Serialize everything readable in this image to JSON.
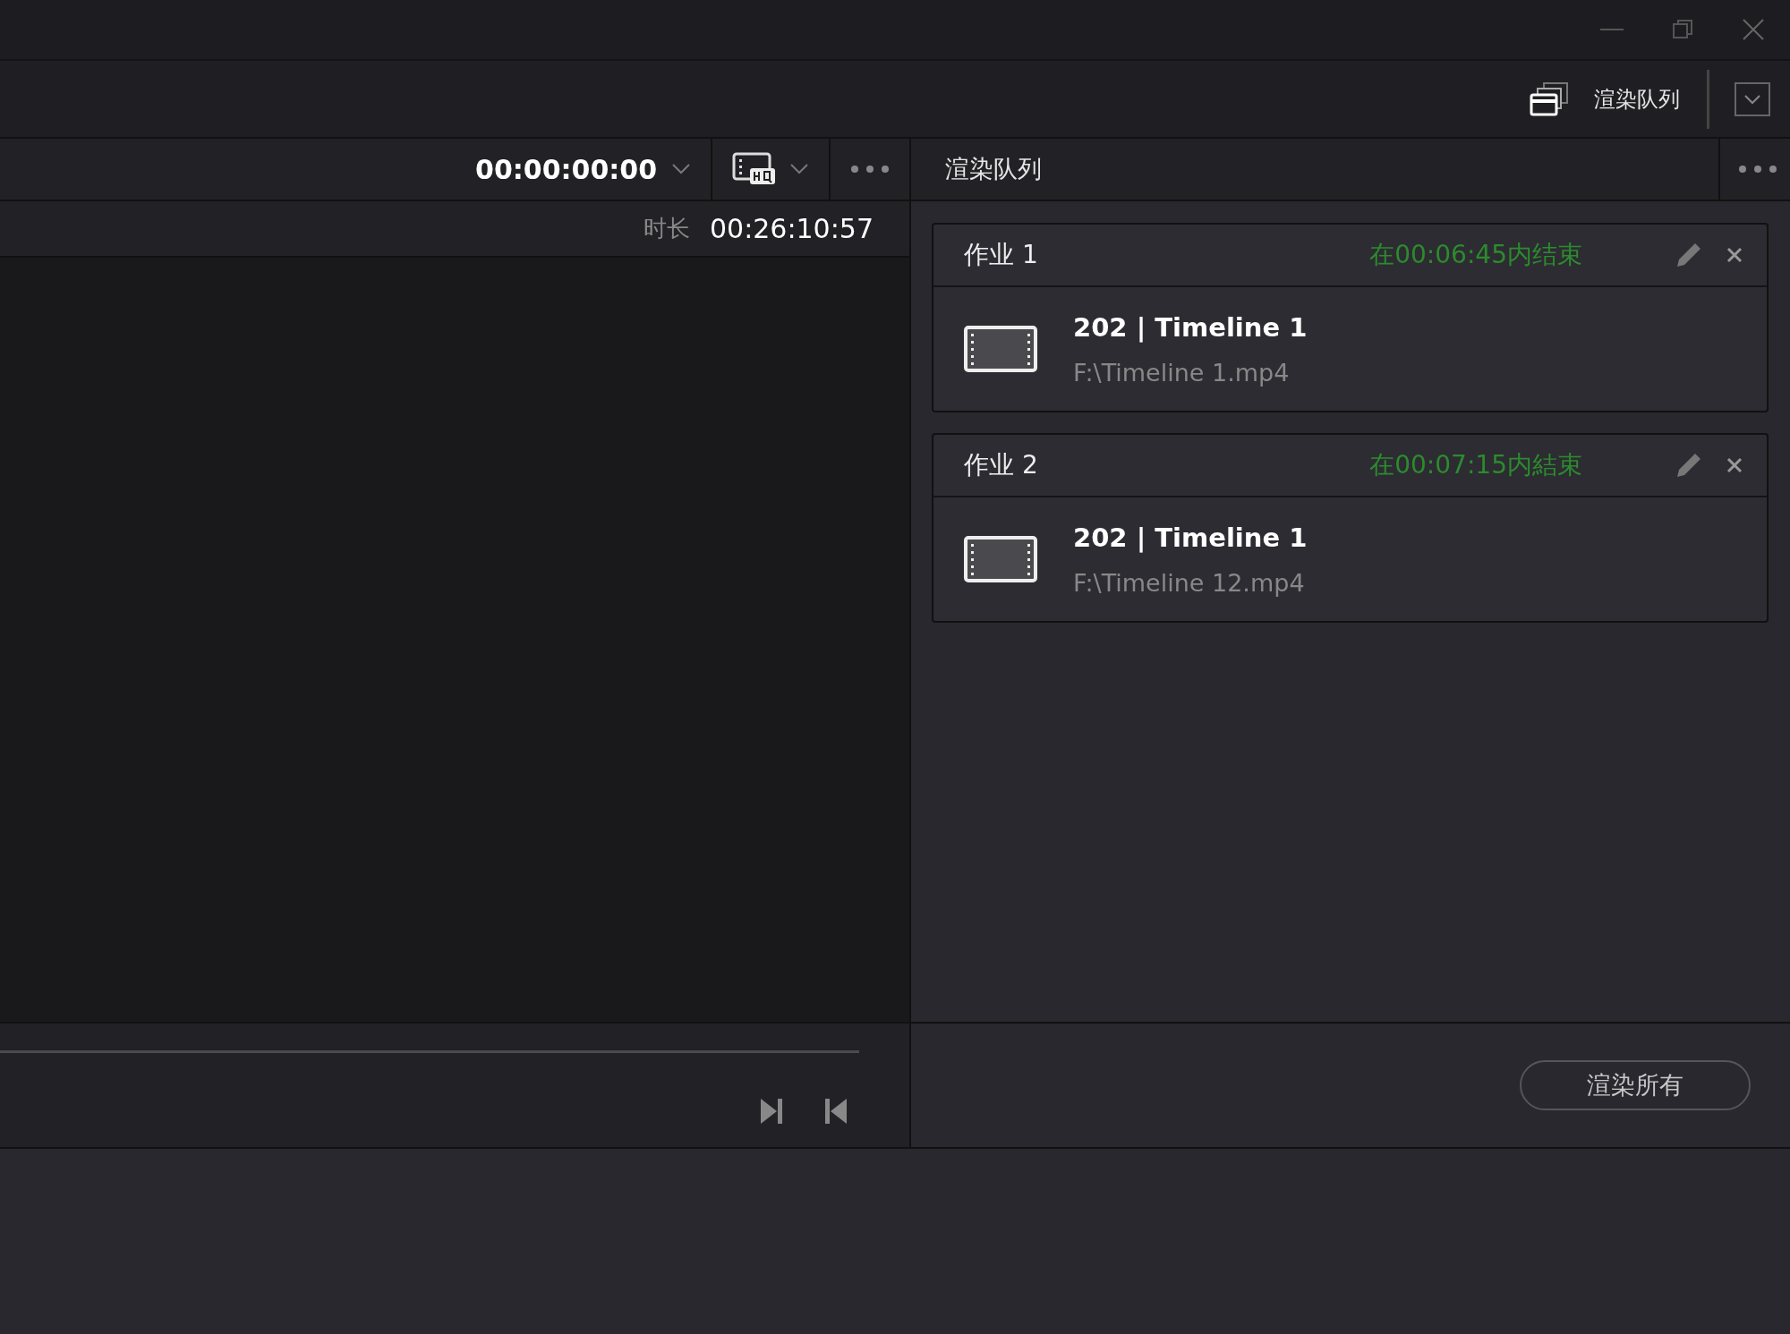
{
  "toolbar": {
    "render_queue_label": "渲染队列"
  },
  "viewer": {
    "timecode": "00:00:00:00",
    "duration_label": "时长",
    "duration": "00:26:10:57"
  },
  "render_queue": {
    "title": "渲染队列",
    "jobs": [
      {
        "title": "作业 1",
        "status": "在00:06:45内结束",
        "name": "202 | Timeline 1",
        "path": "F:\\Timeline 1.mp4"
      },
      {
        "title": "作业 2",
        "status": "在00:07:15内結束",
        "name": "202 | Timeline 1",
        "path": "F:\\Timeline 12.mp4"
      }
    ],
    "render_all_button": "渲染所有"
  }
}
